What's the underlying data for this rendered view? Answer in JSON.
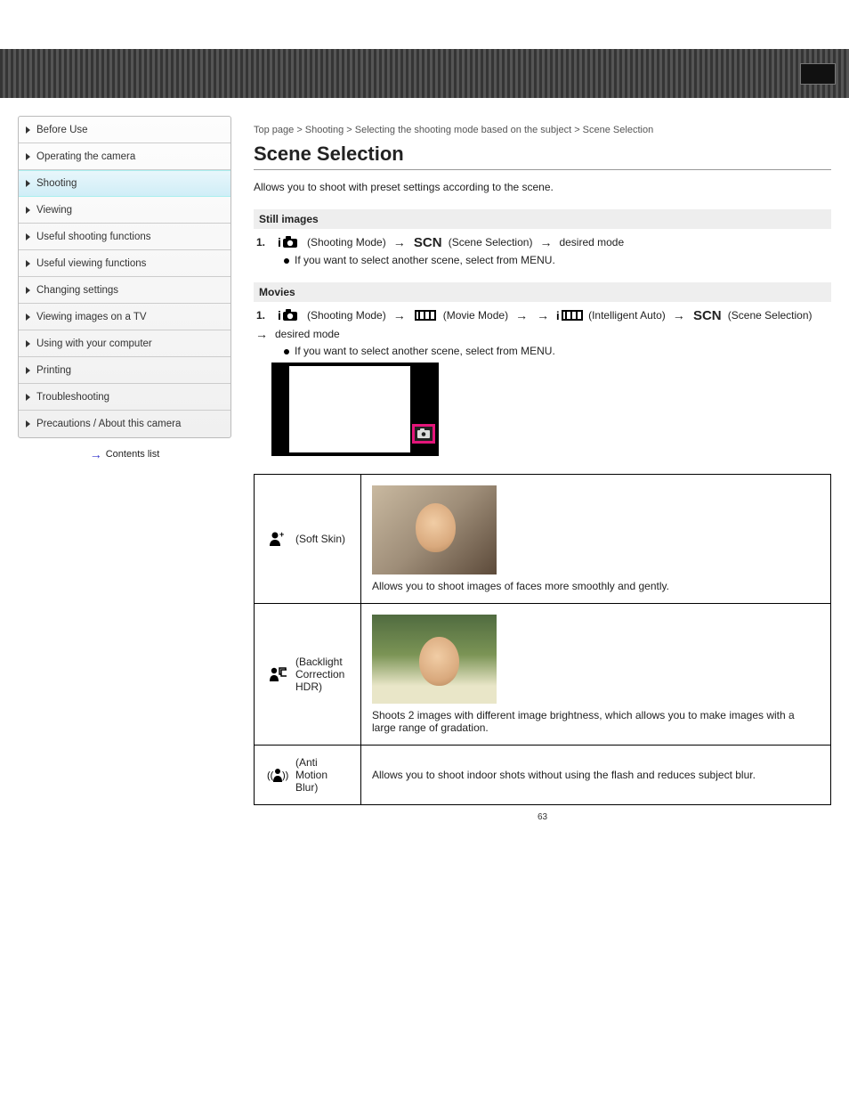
{
  "header": {
    "corner": ""
  },
  "sidebar": {
    "items": [
      {
        "label": "Before Use"
      },
      {
        "label": "Operating the camera"
      },
      {
        "label": "Shooting"
      },
      {
        "label": "Viewing"
      },
      {
        "label": "Useful shooting functions"
      },
      {
        "label": "Useful viewing functions"
      },
      {
        "label": "Changing settings"
      },
      {
        "label": "Viewing images on a TV"
      },
      {
        "label": "Using with your computer"
      },
      {
        "label": "Printing"
      },
      {
        "label": "Troubleshooting"
      },
      {
        "label": "Precautions / About this camera"
      }
    ],
    "back_arrow": "→",
    "back_label": "Contents list"
  },
  "breadcrumb": "Top page > Shooting > Selecting the shooting mode based on the subject > Scene Selection",
  "title": "Scene Selection",
  "intro": "Allows you to shoot with preset settings according to the scene.",
  "steps": {
    "still": {
      "heading": "Still images",
      "num": "1.",
      "part1": "(Shooting Mode)",
      "part2": "(Scene Selection)",
      "part3": "desired mode",
      "sub": "If you want to select another scene, select from MENU."
    },
    "movie": {
      "heading": "Movies",
      "num": "1.",
      "part1": "(Shooting Mode)",
      "part2": "(Movie Mode)",
      "part3a": "(Intelligent Auto)",
      "part4": "(Scene Selection)",
      "part5": "desired mode",
      "sub": "If you want to select another scene, select from MENU."
    }
  },
  "lcd": {
    "btn_icon": "mode-icon"
  },
  "modes": [
    {
      "icon": "soft-skin-icon",
      "name": "(Soft Skin)",
      "desc": "Allows you to shoot images of faces more smoothly and gently."
    },
    {
      "icon": "backlight-portrait-icon",
      "name": "(Backlight Correction HDR)",
      "desc": "Shoots 2 images with different image brightness, which allows you to make images with a large range of gradation."
    },
    {
      "icon": "anti-motion-blur-icon",
      "name": "(Anti Motion Blur)",
      "desc": "Allows you to shoot indoor shots without using the flash and reduces subject blur."
    }
  ],
  "page_number": "63"
}
